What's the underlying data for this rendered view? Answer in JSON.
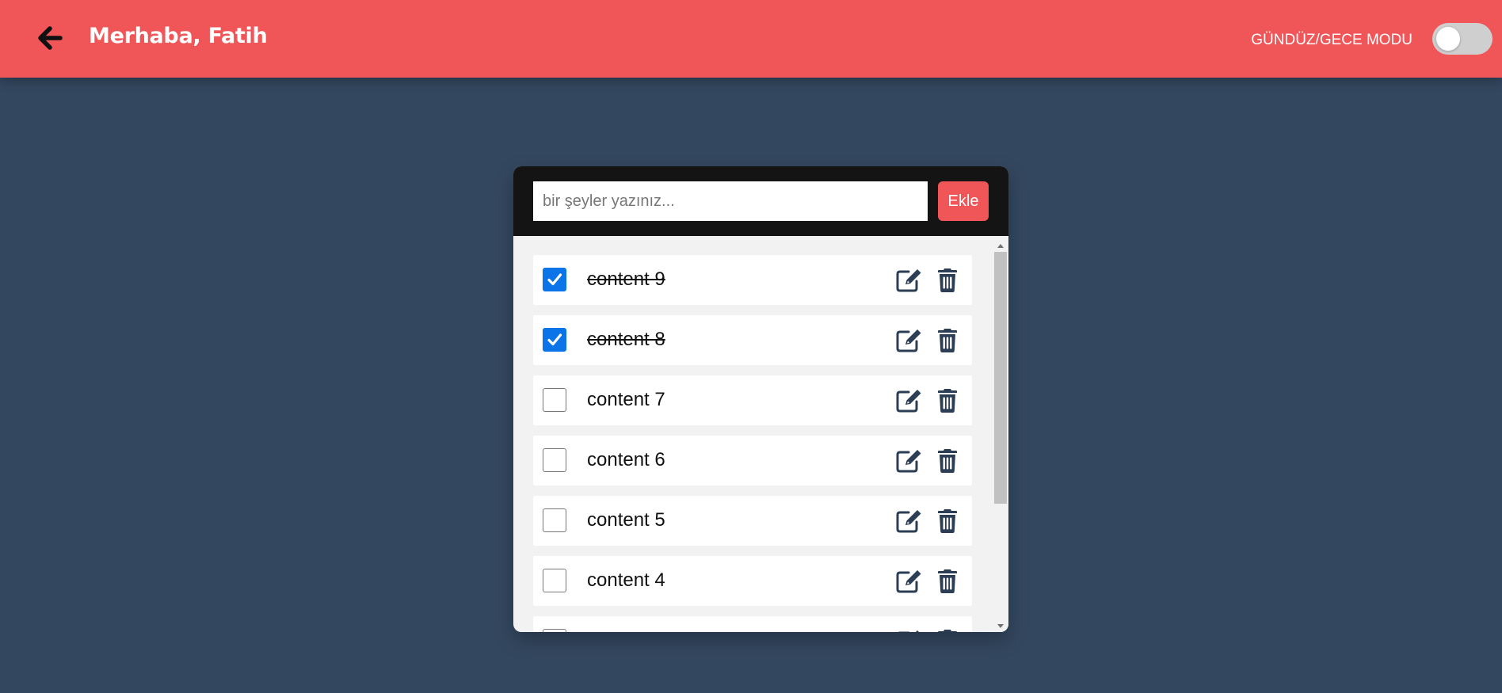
{
  "header": {
    "greeting": "Merhaba, Fatih",
    "back_icon": "arrow-left-icon",
    "mode_label": "GÜNDÜZ/GECE MODU",
    "dark_mode_on": false
  },
  "todo": {
    "input_placeholder": "bir şeyler yazınız...",
    "input_value": "",
    "add_label": "Ekle",
    "items": [
      {
        "text": "content 9",
        "done": true
      },
      {
        "text": "content 8",
        "done": true
      },
      {
        "text": "content 7",
        "done": false
      },
      {
        "text": "content 6",
        "done": false
      },
      {
        "text": "content 5",
        "done": false
      },
      {
        "text": "content 4",
        "done": false
      },
      {
        "text": "",
        "done": false
      }
    ],
    "edit_icon": "edit-icon",
    "delete_icon": "trash-icon"
  },
  "colors": {
    "header_bg": "#f05558",
    "page_bg": "#33475f",
    "accent": "#f05558",
    "checkbox_checked": "#0b74e8",
    "icon": "#2b3e55"
  }
}
